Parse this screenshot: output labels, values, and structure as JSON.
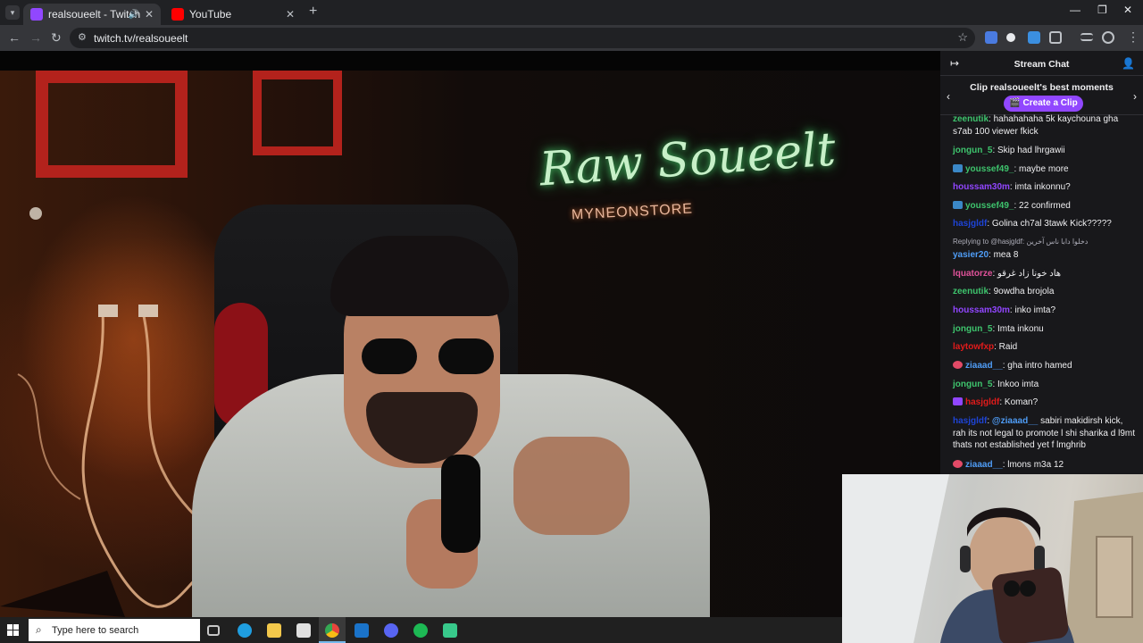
{
  "browser": {
    "tabs": [
      {
        "title": "realsoueelt - Twitch",
        "active": true,
        "favicon_color": "#9147ff"
      },
      {
        "title": "YouTube",
        "active": false,
        "favicon_color": "#ff0000"
      }
    ],
    "new_tab": "+",
    "tab_close": "✕",
    "window_controls": [
      "—",
      "❐",
      "✕"
    ],
    "url": "twitch.tv/realsoueelt"
  },
  "video": {
    "neon_title": "Raw Soueelt",
    "neon_subtitle": "MYNEONSTORE"
  },
  "chat": {
    "header": "Stream Chat",
    "clip_banner": "Clip realsoueelt's best moments",
    "clip_button": "Create a Clip",
    "messages": [
      {
        "user": "zeenutik",
        "color": "#3ec46d",
        "text": ": hahahahaha 5k kaychouna gha s7ab 100 viewer fkick",
        "badge": ""
      },
      {
        "user": "jongun_5",
        "color": "#3ec46d",
        "text": ": Skip had lhrgawii",
        "badge": ""
      },
      {
        "user": "youssef49_",
        "color": "#3ec46d",
        "text": ": maybe more",
        "badge": "#3b88c7"
      },
      {
        "user": "houssam30m",
        "color": "#9146ff",
        "text": ": imta inkonnu?",
        "badge": ""
      },
      {
        "user": "youssef49_",
        "color": "#3ec46d",
        "text": ": 22 confirmed",
        "badge": "#3b88c7"
      },
      {
        "user": "hasjgldf",
        "color": "#1e44d6",
        "text": ": Golina ch7al 3tawk Kick?????",
        "badge": ""
      },
      {
        "user": "yasier20",
        "color": "#4f9df7",
        "text": ": mea 8",
        "badge": ""
      },
      {
        "user": "lquatorze",
        "color": "#e0529a",
        "text": ": هاد خونا زاد غرقو",
        "badge": ""
      },
      {
        "user": "zeenutik",
        "color": "#3ec46d",
        "text": ": 9owdha brojola",
        "badge": ""
      },
      {
        "user": "houssam30m",
        "color": "#9146ff",
        "text": ": inko imta?",
        "badge": ""
      },
      {
        "user": "jongun_5",
        "color": "#3ec46d",
        "text": ": Imta inkonu",
        "badge": ""
      },
      {
        "user": "laytowfxp",
        "color": "#e21b1b",
        "text": ": Raid",
        "badge": ""
      },
      {
        "user": "ziaaad__",
        "color": "#4f9df7",
        "text": ": gha intro hamed",
        "badge": "#e24a67"
      },
      {
        "user": "jongun_5",
        "color": "#3ec46d",
        "text": ": Inkoo imta",
        "badge": ""
      },
      {
        "user": "hasjgldf",
        "color": "#e21b1b",
        "text": ": Koman?",
        "badge": "#9146ff"
      },
      {
        "user": "hasjgldf",
        "color": "#1e44d6",
        "mention": "@ziaaad__",
        "text": " sabiri makidirsh kick, rah its not legal to promote l shi sharika d l9mt thats not established yet f lmghrib",
        "badge": ""
      },
      {
        "user": "ziaaad__",
        "color": "#4f9df7",
        "text": ": lmons m3a 12",
        "badge": "#e24a67"
      }
    ],
    "reply_to": "Replying to @hasjgldf: دخلوا دابا ناس آخرين"
  },
  "taskbar": {
    "search_placeholder": "Type here to search",
    "pinned": [
      {
        "name": "task-view-icon",
        "color": "#c8c8c8"
      },
      {
        "name": "edge-icon",
        "color": "#1f9ee0"
      },
      {
        "name": "file-explorer-icon",
        "color": "#f3c84b"
      },
      {
        "name": "store-icon",
        "color": "#e0e0e0"
      },
      {
        "name": "chrome-icon",
        "color": "#e8453c"
      },
      {
        "name": "outlook-icon",
        "color": "#1a73c9"
      },
      {
        "name": "discord-icon",
        "color": "#5865f2"
      },
      {
        "name": "spotify-icon",
        "color": "#1db954"
      },
      {
        "name": "app-icon",
        "color": "#38c98b"
      }
    ]
  }
}
